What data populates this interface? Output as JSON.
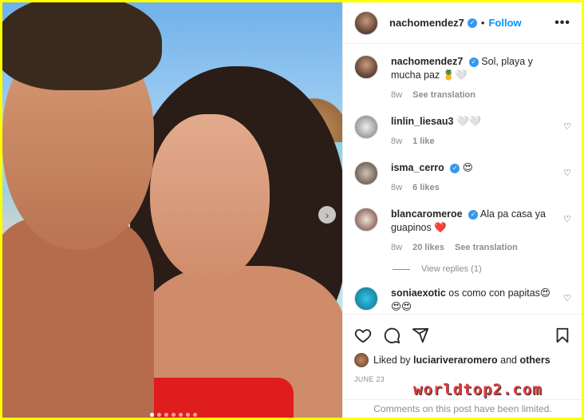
{
  "post": {
    "username": "nachomendez7",
    "follow_label": "Follow",
    "more_label": "•••",
    "dot": "•"
  },
  "caption": {
    "username": "nachomendez7",
    "text": "Sol, playa y mucha paz 🍍🤍",
    "age": "8w",
    "see_translation": "See translation"
  },
  "comments": [
    {
      "username": "linlin_liesau3",
      "verified": false,
      "text": "🤍🤍",
      "age": "8w",
      "likes": "1 like",
      "extra": ""
    },
    {
      "username": "isma_cerro",
      "verified": true,
      "text": "😍",
      "age": "8w",
      "likes": "6 likes",
      "extra": ""
    },
    {
      "username": "blancaromeroe",
      "verified": true,
      "text": "Ala pa casa ya guapinos ❤️",
      "age": "8w",
      "likes": "20 likes",
      "extra": "See translation"
    },
    {
      "username": "soniaexotic",
      "verified": false,
      "text": "os como con papitas😍 😍😍",
      "age": "",
      "likes": "",
      "extra": ""
    }
  ],
  "view_replies": "View replies (1)",
  "likes": {
    "prefix": "Liked by",
    "user": "luciariveraromero",
    "and": "and",
    "others": "others"
  },
  "date": "JUNE 23",
  "limited_notice": "Comments on this post have been limited.",
  "watermark": "worldtop2.com",
  "icons": {
    "heart": "heart-icon",
    "comment": "comment-icon",
    "share": "share-icon",
    "save": "bookmark-icon"
  },
  "colors": {
    "accent": "#0095f6",
    "border": "#ffff00",
    "verified": "#3897f0"
  }
}
